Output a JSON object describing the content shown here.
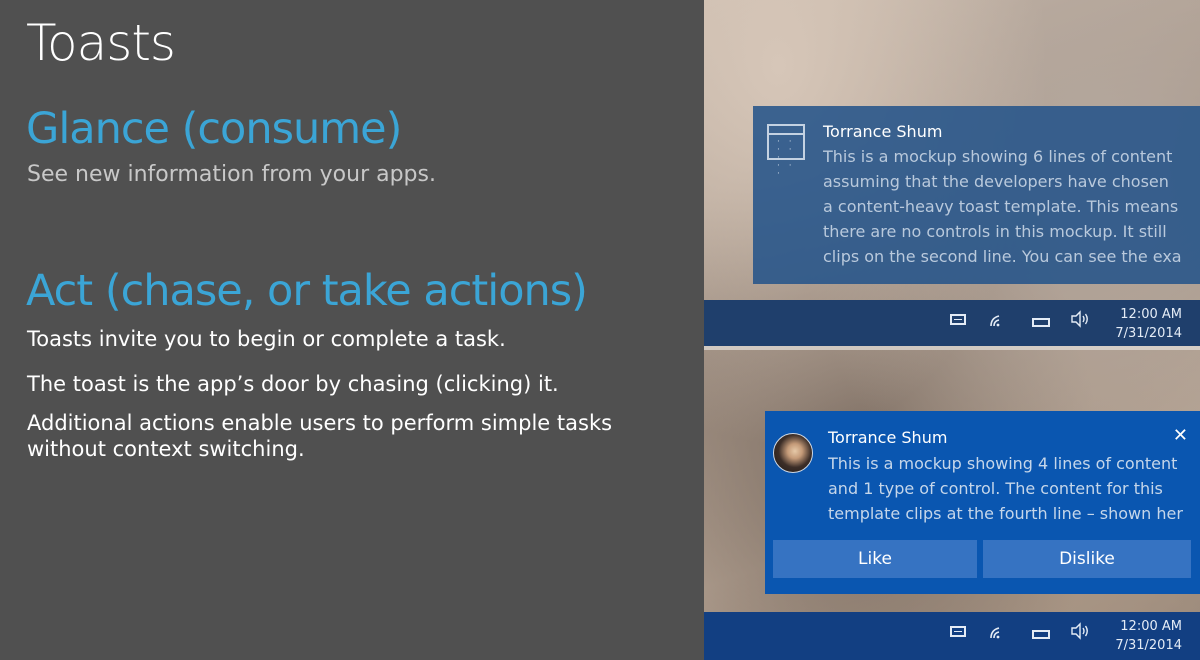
{
  "slide": {
    "title": "Toasts",
    "glance_heading": "Glance (consume)",
    "glance_text": "See new information from your apps.",
    "act_heading": "Act (chase, or take actions)",
    "act_points": [
      "Toasts invite you to begin or complete a task.",
      "The toast is the app’s door by chasing (clicking) it.",
      "Additional actions enable users to perform simple tasks without context switching."
    ]
  },
  "colors": {
    "accent": "#3ba5d6",
    "slide_bg": "#505050",
    "toast_blue": "#0a56b0",
    "toast_button": "#3673c2"
  },
  "toast1": {
    "icon": "calendar-app-icon",
    "sender": "Torrance Shum",
    "lines": [
      "This is a mockup showing 6 lines of content",
      "assuming that the developers have chosen",
      "a content-heavy toast template. This means",
      "there are no controls in this mockup. It still",
      "clips on the second line. You can see the exa"
    ]
  },
  "taskbar1": {
    "time": "12:00 AM",
    "date": "7/31/2014",
    "tray_icons": [
      "action-center-icon",
      "wifi-icon",
      "battery-icon",
      "volume-icon"
    ]
  },
  "toast2": {
    "sender": "Torrance Shum",
    "close_glyph": "✕",
    "lines": [
      "This is a mockup showing 4 lines of content",
      "and 1 type of control. The content for this",
      "template clips at the fourth line – shown her"
    ],
    "buttons": {
      "like": "Like",
      "dislike": "Dislike"
    }
  },
  "taskbar2": {
    "time": "12:00 AM",
    "date": "7/31/2014",
    "tray_icons": [
      "action-center-icon",
      "wifi-icon",
      "battery-icon",
      "volume-icon"
    ]
  }
}
